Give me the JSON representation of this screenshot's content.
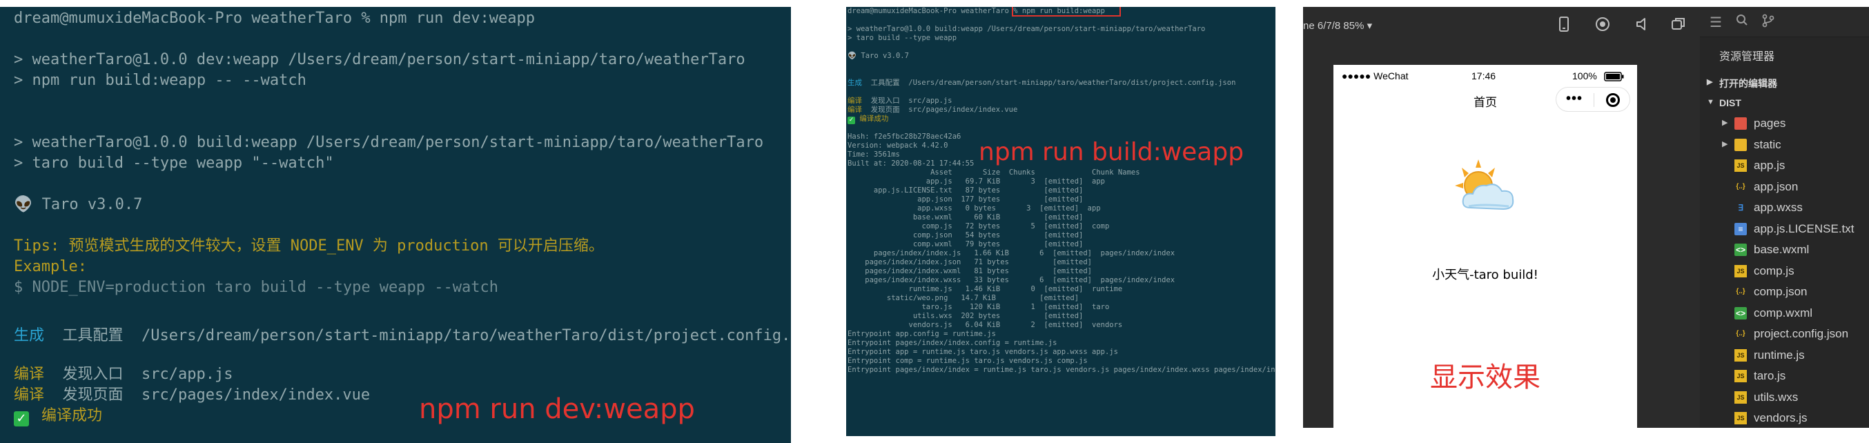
{
  "dev_terminal": {
    "lines": [
      "dream@mumuxideMacBook-Pro weatherTaro % npm run dev:weapp",
      "",
      "> weatherTaro@1.0.0 dev:weapp /Users/dream/person/start-miniapp/taro/weatherTaro",
      "> npm run build:weapp -- --watch",
      "",
      "",
      "> weatherTaro@1.0.0 build:weapp /Users/dream/person/start-miniapp/taro/weatherTaro",
      "> taro build --type weapp \"--watch\"",
      "",
      "👽 Taro v3.0.7",
      "",
      "Tips: 预览模式生成的文件较大，设置 NODE_ENV 为 production 可以开启压缩。",
      "Example:",
      "$ NODE_ENV=production taro build --type weapp --watch"
    ],
    "generate_label": "生成",
    "generate_text": "  工具配置  /Users/dream/person/start-miniapp/taro/weatherTaro/dist/project.config.json",
    "compile1_label": "编译",
    "compile1_text": "  发现入口  src/app.js",
    "compile2_label": "编译",
    "compile2_text": "  发现页面  src/pages/index/index.vue",
    "success_check": "✓",
    "success_text": "编译成功",
    "caption": "npm run dev:weapp"
  },
  "build_terminal": {
    "prompt": "dream@mumuxideMacBook-Pro weatherTaro % ",
    "command": "npm run build:weapp",
    "lines": [
      "",
      "> weatherTaro@1.0.0 build:weapp /Users/dream/person/start-miniapp/taro/weatherTaro",
      "> taro build --type weapp",
      "",
      "👽 Taro v3.0.7",
      ""
    ],
    "generate_label": "生成",
    "generate_text": "  工具配置  /Users/dream/person/start-miniapp/taro/weatherTaro/dist/project.config.json",
    "compile1_label": "编译",
    "compile1_text": "  发现入口  src/app.js",
    "compile2_label": "编译",
    "compile2_text": "  发现页面  src/pages/index/index.vue",
    "success_check": "✓",
    "success_text": " 编译成功",
    "stats": [
      "",
      "Hash: f2e5fbc28b278aec42a6",
      "Version: webpack 4.42.0",
      "Time: 3561ms",
      "Built at: 2020-08-21 17:44:55",
      "                   Asset       Size  Chunks             Chunk Names",
      "                  app.js   69.7 KiB       3  [emitted]  app",
      "      app.js.LICENSE.txt   87 bytes          [emitted]",
      "                app.json  177 bytes          [emitted]",
      "                app.wxss   0 bytes       3  [emitted]  app",
      "               base.wxml     60 KiB          [emitted]",
      "                 comp.js   72 bytes       5  [emitted]  comp",
      "               comp.json   54 bytes          [emitted]",
      "               comp.wxml   79 bytes          [emitted]",
      "      pages/index/index.js   1.66 KiB       6  [emitted]  pages/index/index",
      "    pages/index/index.json   71 bytes          [emitted]",
      "    pages/index/index.wxml   81 bytes          [emitted]",
      "    pages/index/index.wxss   33 bytes       6  [emitted]  pages/index/index",
      "              runtime.js   1.46 KiB       0  [emitted]  runtime",
      "         static/weo.png   14.7 KiB          [emitted]",
      "                 taro.js    120 KiB       1  [emitted]  taro",
      "               utils.wxs  202 bytes          [emitted]",
      "              vendors.js   6.04 KiB       2  [emitted]  vendors",
      "Entrypoint app.config = runtime.js",
      "Entrypoint pages/index/index.config = runtime.js",
      "Entrypoint app = runtime.js taro.js vendors.js app.wxss app.js",
      "Entrypoint comp = runtime.js taro.js vendors.js comp.js",
      "Entrypoint pages/index/index = runtime.js taro.js vendors.js pages/index/index.wxss pages/index/index.js"
    ],
    "caption": "npm run build:weapp"
  },
  "simulator": {
    "device_label": "ne 6/7/8 85% ▾",
    "toolbar_icons": [
      "phone-icon",
      "record-icon",
      "sound-icon",
      "window-icon"
    ],
    "status_carrier": "●●●●● WeChat",
    "status_time": "17:46",
    "status_battery": "100%",
    "nav_title": "首页",
    "capsule_dots": "•••",
    "hello_text": "小天气-taro build!",
    "result_caption": "显示效果"
  },
  "explorer": {
    "title": "资源管理器",
    "section_open_editors": "打开的编辑器",
    "section_dist": "DIST",
    "items": [
      {
        "name": "pages",
        "icon": "folder-red",
        "folder": true
      },
      {
        "name": "static",
        "icon": "folder-yellow",
        "folder": true
      },
      {
        "name": "app.js",
        "icon": "js",
        "folder": false
      },
      {
        "name": "app.json",
        "icon": "json",
        "folder": false
      },
      {
        "name": "app.wxss",
        "icon": "wxss",
        "folder": false
      },
      {
        "name": "app.js.LICENSE.txt",
        "icon": "txt",
        "folder": false
      },
      {
        "name": "base.wxml",
        "icon": "wxml",
        "folder": false
      },
      {
        "name": "comp.js",
        "icon": "js",
        "folder": false
      },
      {
        "name": "comp.json",
        "icon": "json",
        "folder": false
      },
      {
        "name": "comp.wxml",
        "icon": "wxml",
        "folder": false
      },
      {
        "name": "project.config.json",
        "icon": "json",
        "folder": false
      },
      {
        "name": "runtime.js",
        "icon": "js",
        "folder": false
      },
      {
        "name": "taro.js",
        "icon": "js",
        "folder": false
      },
      {
        "name": "utils.wxs",
        "icon": "js",
        "folder": false
      },
      {
        "name": "vendors.js",
        "icon": "js",
        "folder": false
      }
    ]
  }
}
